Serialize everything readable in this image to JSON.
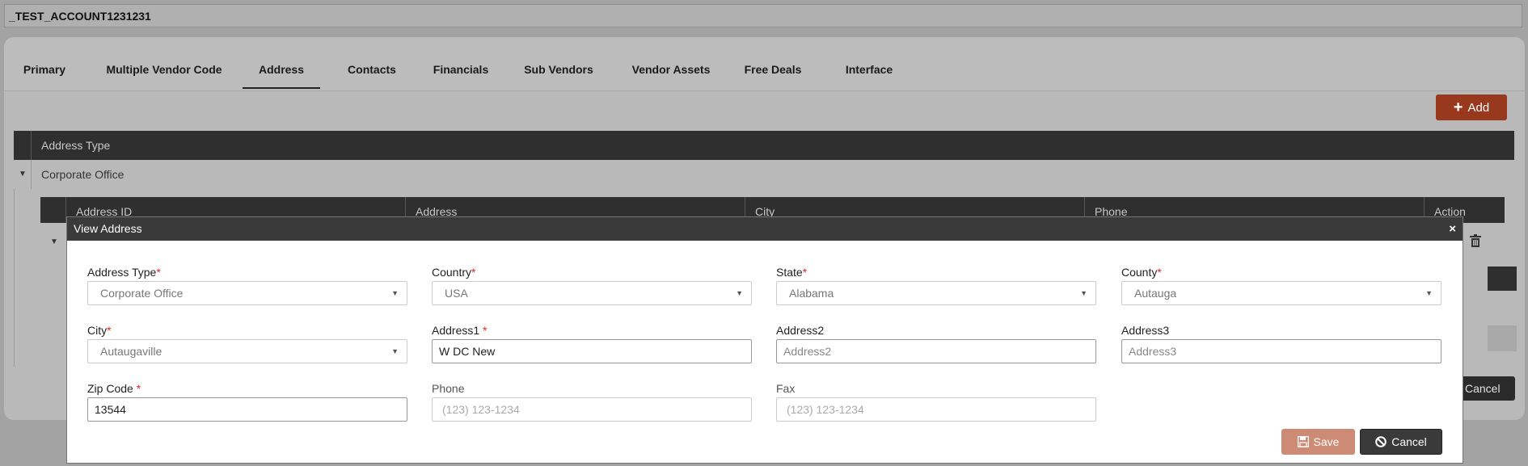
{
  "account": {
    "title": "_TEST_ACCOUNT1231231"
  },
  "tabs": [
    {
      "label": "Primary"
    },
    {
      "label": "Multiple Vendor Code"
    },
    {
      "label": "Address"
    },
    {
      "label": "Contacts"
    },
    {
      "label": "Financials"
    },
    {
      "label": "Sub Vendors"
    },
    {
      "label": "Vendor Assets"
    },
    {
      "label": "Free Deals"
    },
    {
      "label": "Interface"
    }
  ],
  "active_tab": "Address",
  "toolbar": {
    "add_label": "Add"
  },
  "grid": {
    "group_header": "Address Type",
    "group_value": "Corporate Office",
    "columns": [
      "Address ID",
      "Address",
      "City",
      "Phone",
      "Action"
    ]
  },
  "background": {
    "cancel_label": "Cancel"
  },
  "modal": {
    "title": "View Address",
    "close_glyph": "×",
    "fields": {
      "address_type": {
        "label": "Address Type",
        "required": "*",
        "value": "Corporate Office"
      },
      "country": {
        "label": "Country",
        "required": "*",
        "value": "USA"
      },
      "state": {
        "label": "State",
        "required": "*",
        "value": "Alabama"
      },
      "county": {
        "label": "County",
        "required": "*",
        "value": "Autauga"
      },
      "city": {
        "label": "City",
        "required": "*",
        "value": "Autaugaville"
      },
      "address1": {
        "label": "Address1",
        "required": "*",
        "value": "W DC New"
      },
      "address2": {
        "label": "Address2",
        "placeholder": "Address2"
      },
      "address3": {
        "label": "Address3",
        "placeholder": "Address3"
      },
      "zip": {
        "label": "Zip Code",
        "required": "*",
        "value": "13544"
      },
      "phone": {
        "label": "Phone",
        "placeholder": "(123) 123-1234"
      },
      "fax": {
        "label": "Fax",
        "placeholder": "(123) 123-1234"
      }
    },
    "save_label": "Save",
    "cancel_label": "Cancel"
  },
  "colors": {
    "accent": "#98381c",
    "save_disabled": "#cd8a74",
    "header_dark": "#2f2f2f",
    "required": "#e0261c"
  }
}
